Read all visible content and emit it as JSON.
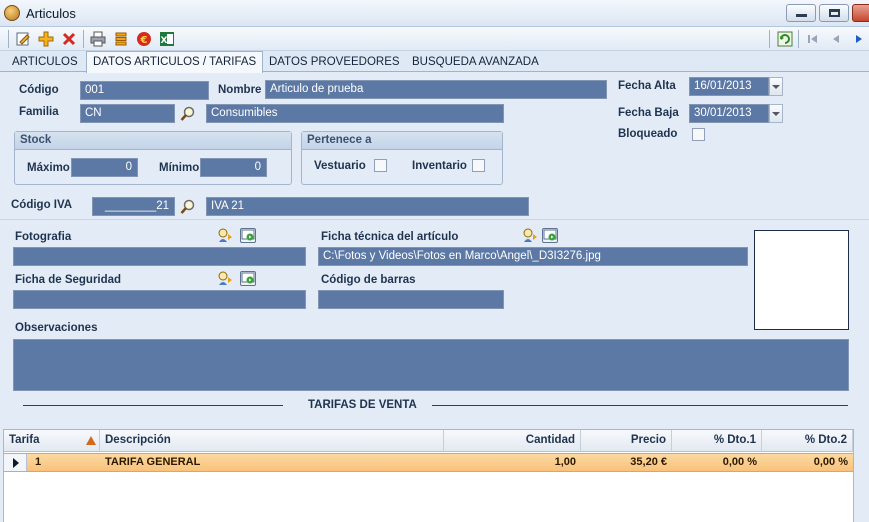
{
  "window": {
    "title": "Articulos"
  },
  "toolbar": {
    "icons": [
      "edit-icon",
      "add-icon",
      "delete-icon",
      "print-icon",
      "stack-icon",
      "euro-icon",
      "excel-icon",
      "refresh-icon",
      "first-icon",
      "prev-icon",
      "next-icon"
    ],
    "excel_glyph": "X",
    "euro_glyph": "€"
  },
  "tabs": [
    {
      "label": "ARTICULOS",
      "active": false
    },
    {
      "label": "DATOS ARTICULOS / TARIFAS",
      "active": true
    },
    {
      "label": "DATOS PROVEEDORES",
      "active": false
    },
    {
      "label": "BUSQUEDA AVANZADA",
      "active": false
    }
  ],
  "form": {
    "codigo": {
      "label": "Código",
      "value": "001"
    },
    "nombre": {
      "label": "Nombre",
      "value": "Articulo de prueba"
    },
    "familia": {
      "label": "Familia",
      "code": "CN",
      "description": "Consumibles"
    },
    "fecha_alta": {
      "label": "Fecha Alta",
      "value": "16/01/2013"
    },
    "fecha_baja": {
      "label": "Fecha Baja",
      "value": "30/01/2013"
    },
    "bloqueado": {
      "label": "Bloqueado",
      "checked": false
    },
    "stock": {
      "title": "Stock",
      "maximo_label": "Máximo",
      "maximo": "0",
      "minimo_label": "Mínimo",
      "minimo": "0"
    },
    "pertenece": {
      "title": "Pertenece a",
      "vestuario_label": "Vestuario",
      "inventario_label": "Inventario"
    },
    "codigo_iva": {
      "label": "Código IVA",
      "value": "________21",
      "description": "IVA 21"
    },
    "fotografia": {
      "label": "Fotografia",
      "value": ""
    },
    "ficha_tecnica": {
      "label": "Ficha técnica del artículo",
      "value": "C:\\Fotos y Videos\\Fotos en Marco\\Angel\\_D3I3276.jpg"
    },
    "ficha_seguridad": {
      "label": "Ficha de Seguridad",
      "value": ""
    },
    "codigo_barras": {
      "label": "Código de barras",
      "value": ""
    },
    "observaciones": {
      "label": "Observaciones",
      "value": ""
    }
  },
  "tarifas": {
    "section_title": "TARIFAS DE VENTA",
    "columns": [
      "Tarifa",
      "Descripción",
      "Cantidad",
      "Precio",
      "% Dto.1",
      "% Dto.2"
    ],
    "rows": [
      {
        "tarifa": "1",
        "descripcion": "TARIFA GENERAL",
        "cantidad": "1,00",
        "precio": "35,20 €",
        "dto1": "0,00 %",
        "dto2": "0,00 %"
      }
    ]
  },
  "colors": {
    "field_fill": "#5c78a4",
    "selected_row": "#f9c27a",
    "panel_bg": "#e3ecf6"
  }
}
